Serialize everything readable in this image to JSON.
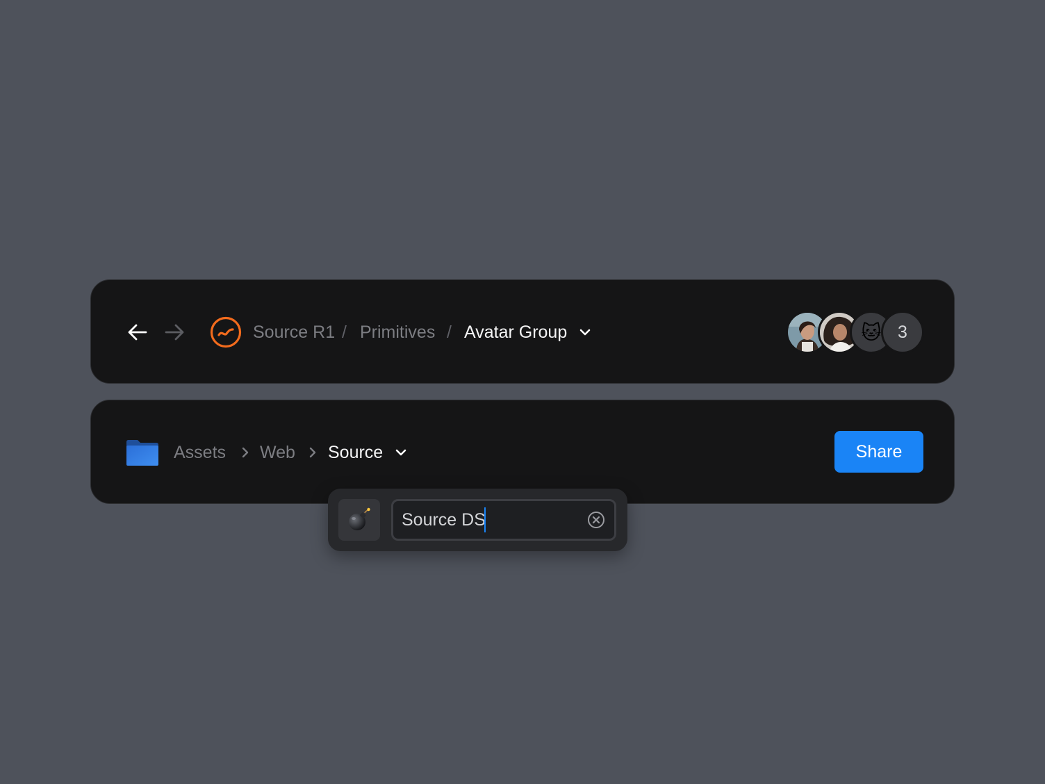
{
  "top_bar": {
    "back_icon": "arrow-left-icon",
    "forward_icon": "arrow-right-icon",
    "logo_icon": "source-logo-icon",
    "breadcrumbs": [
      "Source R1",
      "Primitives",
      "Avatar Group"
    ],
    "separator": "/",
    "dropdown_icon": "chevron-down-icon",
    "avatars": {
      "items": [
        "person-photo-1",
        "person-photo-2",
        "cat-emoji"
      ],
      "cat_emoji": "🐱",
      "overflow_count": "3"
    }
  },
  "bottom_bar": {
    "folder_icon": "folder-icon",
    "breadcrumbs": [
      "Assets",
      "Web",
      "Source"
    ],
    "separator_icon": "chevron-right-icon",
    "dropdown_icon": "chevron-down-icon",
    "share_label": "Share"
  },
  "rename_popover": {
    "emoji_icon": "bomb-icon",
    "input_value": "Source DS",
    "clear_icon": "clear-circle-icon"
  },
  "colors": {
    "background": "#4e525b",
    "bar": "#151516",
    "accent": "#1a84f6",
    "logo": "#f26b1d"
  }
}
